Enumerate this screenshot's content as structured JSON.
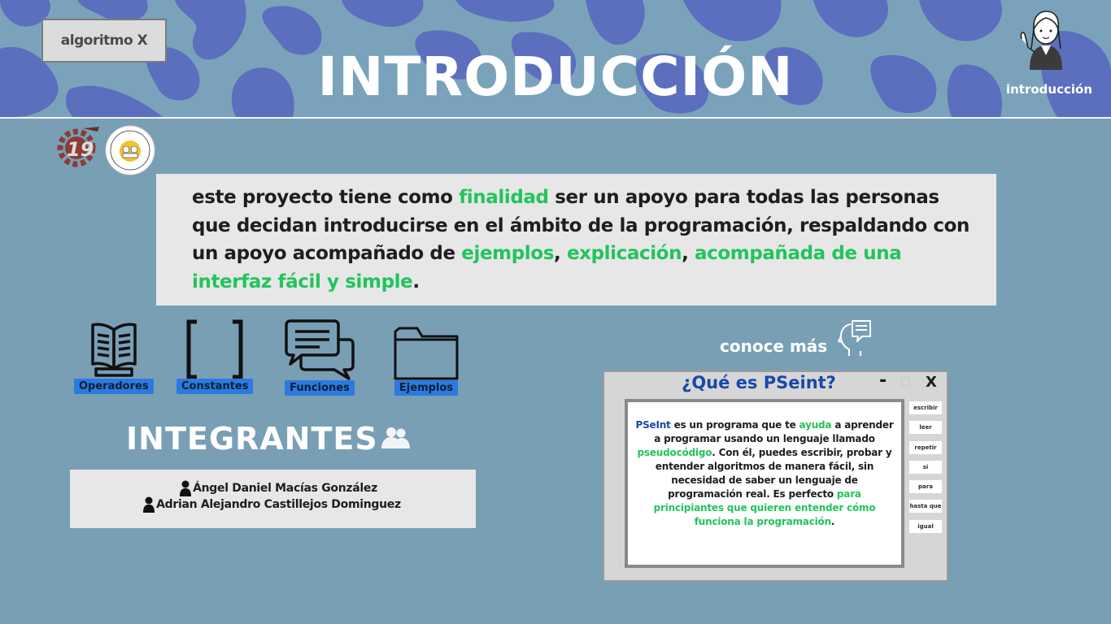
{
  "header": {
    "brand_button": "algoritmo X",
    "title": "INTRODUCCIÓN",
    "section_label": "introducción"
  },
  "intro": {
    "segments": [
      {
        "text": "este proyecto tiene como ",
        "highlight": false
      },
      {
        "text": "finalidad",
        "highlight": true
      },
      {
        "text": " ser un apoyo para todas las personas que decidan introducirse en el ámbito de la programación, respaldando con un apoyo acompañado de ",
        "highlight": false
      },
      {
        "text": "ejemplos",
        "highlight": true
      },
      {
        "text": ", ",
        "highlight": false
      },
      {
        "text": "explicación",
        "highlight": true
      },
      {
        "text": ", ",
        "highlight": false
      },
      {
        "text": "acompañada de una interfaz fácil y simple",
        "highlight": true
      },
      {
        "text": ".",
        "highlight": false
      }
    ]
  },
  "features": [
    {
      "label": "Operadores",
      "icon": "book-icon"
    },
    {
      "label": "Constantes",
      "icon": "brackets-icon"
    },
    {
      "label": "Funciones",
      "icon": "chat-bubbles-icon"
    },
    {
      "label": "Ejemplos",
      "icon": "folder-icon"
    }
  ],
  "team": {
    "title": "INTEGRANTES",
    "members": [
      "Ángel Daniel Macías González",
      "Adrian Alejandro Castillejos Dominguez"
    ]
  },
  "more": {
    "label": "conoce más"
  },
  "pseint": {
    "title": "¿Qué es PSeint?",
    "min_glyph": "-",
    "close_glyph": "X",
    "segments": [
      {
        "text": "PSeInt",
        "style": "blue"
      },
      {
        "text": " es un programa que te ",
        "style": "plain"
      },
      {
        "text": "ayuda",
        "style": "green"
      },
      {
        "text": " a aprender a programar usando un lenguaje llamado ",
        "style": "plain"
      },
      {
        "text": "pseudocódigo",
        "style": "green"
      },
      {
        "text": ". Con él, puedes escribir, probar y entender algoritmos de manera fácil, sin necesidad de saber un lenguaje de programación real. Es perfecto ",
        "style": "plain"
      },
      {
        "text": "para principiantes que quieren entender cómo funciona la programación",
        "style": "green"
      },
      {
        "text": ".",
        "style": "plain"
      }
    ],
    "side_buttons": [
      "escribir",
      "leer",
      "repetir",
      "si",
      "para",
      "hasta que",
      "igual"
    ]
  },
  "colors": {
    "background": "#799fb5",
    "pattern": "#5b6fbe",
    "highlight_green": "#22c45c",
    "title_blue": "#1848a8",
    "label_blue": "#2b7ae0",
    "panel_gray": "#e7e7e7"
  }
}
